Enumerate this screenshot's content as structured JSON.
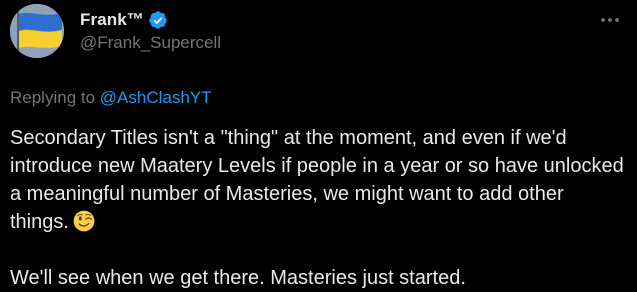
{
  "author": {
    "display_name": "Frank™",
    "handle": "@Frank_Supercell",
    "avatar_icon": "ukraine-flag-avatar",
    "verified_icon": "verified-badge-icon"
  },
  "menu": {
    "more_icon": "more-horizontal-icon"
  },
  "reply_context": {
    "prefix": "Replying to",
    "mention": "@AshClashYT"
  },
  "tweet": {
    "paragraph_1": "Secondary Titles isn't a \"thing\" at the moment, and even if we'd introduce new Maatery Levels if people in a year or so have unlocked a meaningful number of Masteries, we might want to add other things.",
    "emoji_icon": "winking-face-emoji",
    "paragraph_2": "We'll see when we get there. Masteries just started."
  },
  "colors": {
    "background": "#000000",
    "text": "#e7e9ea",
    "secondary_text": "#71767b",
    "accent": "#1d9bf0"
  }
}
